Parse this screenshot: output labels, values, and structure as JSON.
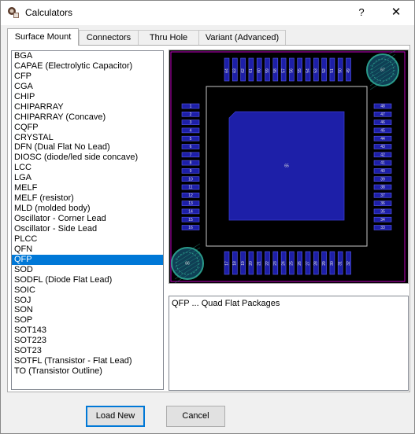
{
  "window": {
    "title": "Calculators",
    "help_label": "?",
    "close_label": "✕"
  },
  "tabs": [
    {
      "label": "Surface Mount",
      "active": true
    },
    {
      "label": "Connectors",
      "active": false
    },
    {
      "label": "Thru Hole",
      "active": false
    },
    {
      "label": "Variant (Advanced)",
      "active": false
    }
  ],
  "package_list": {
    "items": [
      "BGA",
      "CAPAE (Electrolytic Capacitor)",
      "CFP",
      "CGA",
      "CHIP",
      "CHIPARRAY",
      "CHIPARRAY (Concave)",
      "CQFP",
      "CRYSTAL",
      "DFN (Dual Flat No Lead)",
      "DIOSC (diode/led side concave)",
      "LCC",
      "LGA",
      "MELF",
      "MELF (resistor)",
      "MLD (molded body)",
      "Oscillator - Corner Lead",
      "Oscillator - Side Lead",
      "PLCC",
      "QFN",
      "QFP",
      "SOD",
      "SODFL (Diode Flat Lead)",
      "SOIC",
      "SOJ",
      "SON",
      "SOP",
      "SOT143",
      "SOT223",
      "SOT23",
      "SOTFL (Transistor - Flat Lead)",
      "TO (Transistor Outline)"
    ],
    "selected": "QFP"
  },
  "preview": {
    "center_pad_label": "65",
    "top_pads": [
      "64",
      "63",
      "62",
      "61",
      "60",
      "59",
      "58",
      "57",
      "56",
      "55",
      "54",
      "53",
      "52",
      "51",
      "50",
      "49"
    ],
    "left_pads": [
      "1",
      "2",
      "3",
      "4",
      "5",
      "6",
      "7",
      "8",
      "9",
      "10",
      "11",
      "12",
      "13",
      "14",
      "15",
      "16"
    ],
    "right_pads": [
      "48",
      "47",
      "46",
      "45",
      "44",
      "43",
      "42",
      "41",
      "40",
      "39",
      "38",
      "37",
      "36",
      "35",
      "34",
      "33"
    ],
    "bottom_pads": [
      "17",
      "18",
      "19",
      "20",
      "21",
      "22",
      "23",
      "24",
      "25",
      "26",
      "27",
      "28",
      "29",
      "30",
      "31",
      "32"
    ],
    "mounting_hole_top_right": "67",
    "mounting_hole_bottom_left": "66",
    "colors": {
      "background": "#000000",
      "pad": "#1d1fa8",
      "outline": "#c000c0",
      "silkscreen": "#c8c8c8",
      "hole": "#2a9a8a"
    }
  },
  "description": "QFP ... Quad Flat Packages",
  "buttons": {
    "load_new": "Load New",
    "cancel": "Cancel"
  }
}
